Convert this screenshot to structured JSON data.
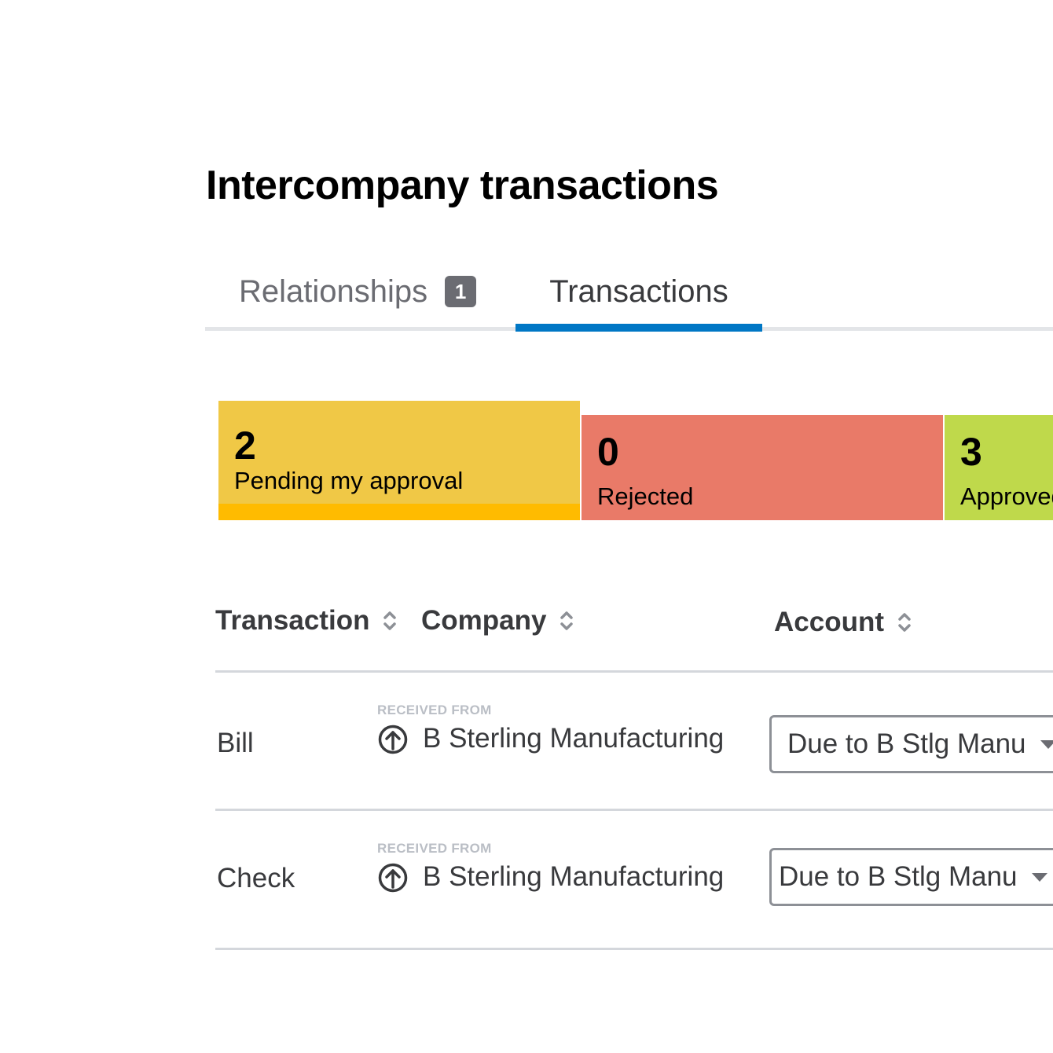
{
  "page": {
    "title": "Intercompany transactions"
  },
  "tabs": [
    {
      "label": "Relationships",
      "badge": "1",
      "active": false
    },
    {
      "label": "Transactions",
      "active": true
    }
  ],
  "status_cards": [
    {
      "count": "2",
      "label": "Pending my approval",
      "color": "#f0c846",
      "accent": "#ffbb00",
      "selected": true
    },
    {
      "count": "0",
      "label": "Rejected",
      "color": "#e97a68"
    },
    {
      "count": "3",
      "label": "Approved",
      "color": "#bfd94b"
    }
  ],
  "table": {
    "columns": [
      {
        "label": "Transaction",
        "sortable": true
      },
      {
        "label": "Company",
        "sortable": true
      },
      {
        "label": "Account",
        "sortable": true
      }
    ],
    "rows": [
      {
        "transaction": "Bill",
        "company_caption": "RECEIVED FROM",
        "company": "B Sterling Manufacturing",
        "account": "Due to B Stlg Manu"
      },
      {
        "transaction": "Check",
        "company_caption": "RECEIVED FROM",
        "company": "B Sterling Manufacturing",
        "account": "Due to B Stlg Manu"
      }
    ]
  },
  "colors": {
    "tab_active_underline": "#0077c5",
    "badge_bg": "#6b6c72"
  }
}
